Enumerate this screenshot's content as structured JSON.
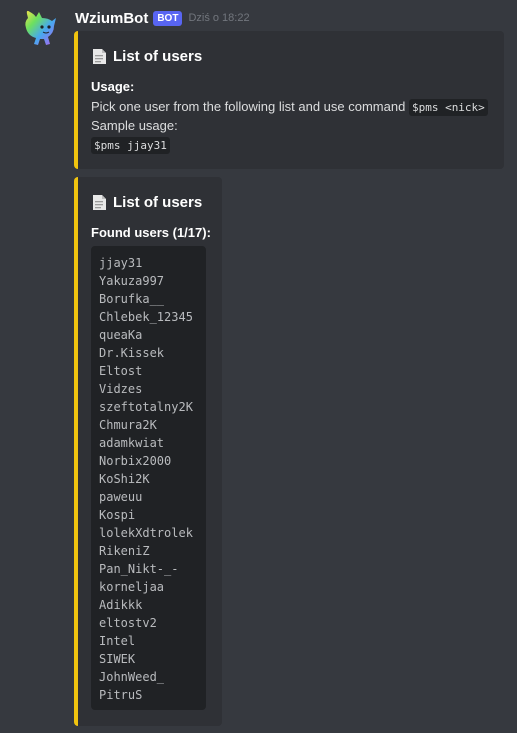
{
  "author": {
    "name": "WziumBot",
    "tag": "BOT",
    "timestamp": "Dziś o 18:22"
  },
  "colors": {
    "embed_accent": "#f1c40f",
    "bot_tag": "#5865f2"
  },
  "embed1": {
    "icon": "document-icon",
    "title": "List of users",
    "field_name": "Usage:",
    "line1_text": "Pick one user from the following list and use command",
    "line1_code": "$pms <nick>",
    "line2_text": "Sample usage:",
    "line3_code": "$pms jjay31"
  },
  "embed2": {
    "icon": "document-icon",
    "title": "List of users",
    "field_name": "Found users (1/17):",
    "users": [
      "jjay31",
      "Yakuza997",
      "Borufka__",
      "Chlebek_12345",
      "queaKa",
      "Dr.Kissek",
      "Eltost",
      "Vidzes",
      "szeftotalny2K",
      "Chmura2K",
      "adamkwiat",
      "Norbix2000",
      "KoShi2K",
      "paweuu",
      "Kospi",
      "lolekXdtrolek",
      "RikeniZ",
      "Pan_Nikt-_-",
      "korneljaa",
      "Adikkk",
      "eltostv2",
      "Intel",
      "SIWEK",
      "JohnWeed_",
      "PitruS"
    ]
  }
}
